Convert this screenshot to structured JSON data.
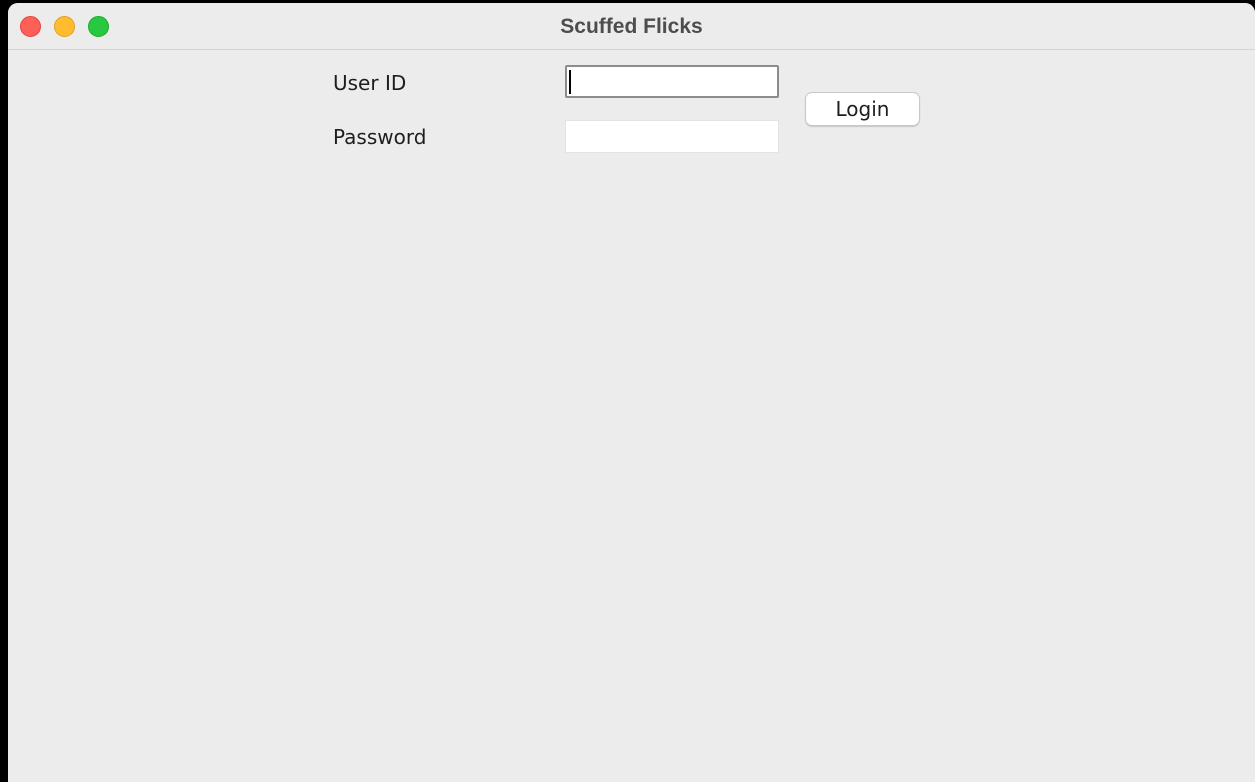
{
  "window": {
    "title": "Scuffed Flicks"
  },
  "login_form": {
    "user_id_label": "User ID",
    "user_id_value": "",
    "password_label": "Password",
    "password_value": "",
    "login_button_label": "Login"
  },
  "colors": {
    "window_background": "#ececec",
    "close_button": "#fe5f57",
    "minimize_button": "#febc2e",
    "zoom_button": "#28c840"
  },
  "icons": {
    "close": "close-window-icon",
    "minimize": "minimize-window-icon",
    "zoom": "zoom-window-icon"
  }
}
